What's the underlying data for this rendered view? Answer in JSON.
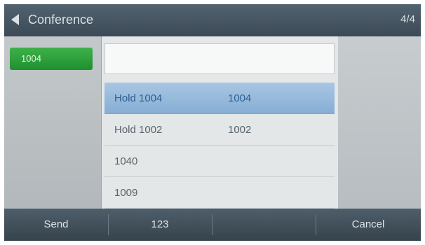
{
  "titlebar": {
    "title": "Conference",
    "page_indicator": "4/4"
  },
  "left": {
    "line_label": "1004"
  },
  "search": {
    "value": ""
  },
  "contacts": [
    {
      "name": "Hold 1004",
      "number": "1004",
      "selected": true
    },
    {
      "name": "Hold 1002",
      "number": "1002",
      "selected": false
    },
    {
      "name": "1040",
      "number": "",
      "selected": false
    },
    {
      "name": "1009",
      "number": "",
      "selected": false
    }
  ],
  "softkeys": {
    "send": "Send",
    "input_mode": "123",
    "empty": "",
    "cancel": "Cancel"
  },
  "colors": {
    "selection": "#8fb5d9",
    "line_badge": "#2a9e38",
    "bar": "#3f4e59"
  }
}
